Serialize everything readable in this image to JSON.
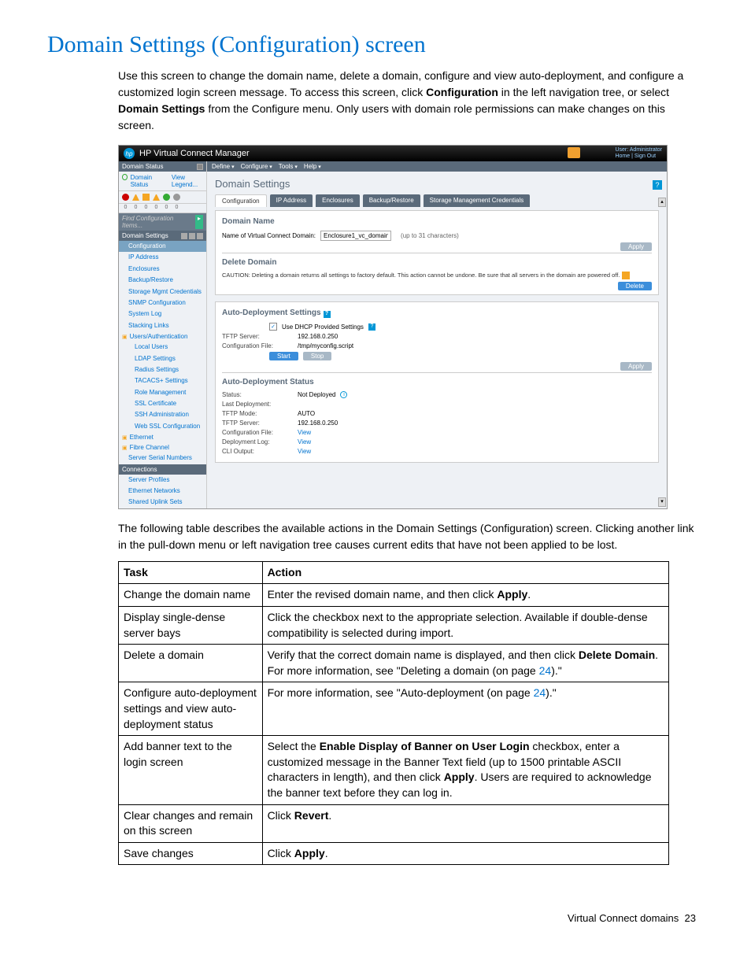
{
  "page": {
    "title": "Domain Settings (Configuration) screen",
    "intro_1a": "Use this screen to change the domain name, delete a domain, configure and view auto-deployment, and configure a customized login screen message. To access this screen, click ",
    "intro_1b": "Configuration",
    "intro_1c": " in the left navigation tree, or select ",
    "intro_1d": "Domain Settings",
    "intro_1e": " from the Configure menu. Only users with domain role permissions can make changes on this screen.",
    "post_text": "The following table describes the available actions in the Domain Settings (Configuration) screen. Clicking another link in the pull-down menu or left navigation tree causes current edits that have not been applied to be lost.",
    "footer_text": "Virtual Connect domains",
    "footer_page": "23"
  },
  "app": {
    "brand": "hp",
    "title": "HP Virtual Connect Manager",
    "user_label": "User: Administrator",
    "links": "Home | Sign Out",
    "menu": [
      "Define",
      "Configure",
      "Tools",
      "Help"
    ],
    "sidebar": {
      "status_header": "Domain Status",
      "status_link": "Domain Status",
      "view_legend": "View Legend...",
      "nums": [
        "0",
        "0",
        "0",
        "0",
        "0",
        "0"
      ],
      "find_placeholder": "Find Configuration Items...",
      "settings_header": "Domain Settings",
      "items1": [
        {
          "label": "Configuration",
          "active": true
        },
        {
          "label": "IP Address"
        },
        {
          "label": "Enclosures"
        },
        {
          "label": "Backup/Restore"
        },
        {
          "label": "Storage Mgmt Credentials"
        },
        {
          "label": "SNMP Configuration"
        },
        {
          "label": "System Log"
        },
        {
          "label": "Stacking Links"
        }
      ],
      "users_header": "Users/Authentication",
      "items2": [
        {
          "label": "Local Users"
        },
        {
          "label": "LDAP Settings"
        },
        {
          "label": "Radius Settings"
        },
        {
          "label": "TACACS+ Settings"
        },
        {
          "label": "Role Management"
        },
        {
          "label": "SSL Certificate"
        },
        {
          "label": "SSH Administration"
        },
        {
          "label": "Web SSL Configuration"
        }
      ],
      "cats": [
        "Ethernet",
        "Fibre Channel"
      ],
      "serial": "Server Serial Numbers",
      "connections": "Connections",
      "items3": [
        "Server Profiles",
        "Ethernet Networks",
        "Shared Uplink Sets"
      ]
    },
    "main": {
      "title": "Domain Settings",
      "tabs": [
        "Configuration",
        "IP Address",
        "Enclosures",
        "Backup/Restore",
        "Storage Management Credentials"
      ],
      "domain_name": {
        "heading": "Domain Name",
        "label": "Name of Virtual Connect Domain:",
        "value": "Enclosure1_vc_domain",
        "hint": "(up to 31 characters)",
        "apply": "Apply"
      },
      "delete": {
        "heading": "Delete Domain",
        "caution": "CAUTION: Deleting a domain returns all settings to factory default. This action cannot be undone. Be sure that all servers in the domain are powered off.",
        "btn": "Delete"
      },
      "autodeploy": {
        "heading": "Auto-Deployment Settings",
        "chk_label": "Use DHCP Provided Settings",
        "tftp_label": "TFTP Server:",
        "tftp_val": "192.168.0.250",
        "cfg_label": "Configuration File:",
        "cfg_val": "/tmp/myconfig.script",
        "start": "Start",
        "stop": "Stop",
        "apply": "Apply"
      },
      "status": {
        "heading": "Auto-Deployment Status",
        "rows": [
          {
            "k": "Status:",
            "v": "Not Deployed",
            "info": true
          },
          {
            "k": "Last Deployment:",
            "v": ""
          },
          {
            "k": "TFTP Mode:",
            "v": "AUTO"
          },
          {
            "k": "TFTP Server:",
            "v": "192.168.0.250"
          },
          {
            "k": "Configuration File:",
            "v": "View",
            "link": true
          },
          {
            "k": "Deployment Log:",
            "v": "View",
            "link": true
          },
          {
            "k": "CLI Output:",
            "v": "View",
            "link": true
          }
        ]
      }
    }
  },
  "table": {
    "headers": [
      "Task",
      "Action"
    ],
    "rows": [
      {
        "task": "Change the domain name",
        "action": "Enter the revised domain name, and then click <b>Apply</b>."
      },
      {
        "task": "Display single-dense server bays",
        "action": "Click the checkbox next to the appropriate selection. Available if double-dense compatibility is selected during import."
      },
      {
        "task": "Delete a domain",
        "action": "Verify that the correct domain name is displayed, and then click <b>Delete Domain</b>. For more information, see \"Deleting a domain (on page <span class='pg-link'>24</span>).\""
      },
      {
        "task": "Configure auto-deployment settings and view auto-deployment status",
        "action": "For more information, see \"Auto-deployment (on page <span class='pg-link'>24</span>).\""
      },
      {
        "task": "Add banner text to the login screen",
        "action": "Select the <b>Enable Display of Banner on User Login</b> checkbox, enter a customized message in the Banner Text field (up to 1500 printable ASCII characters in length), and then click <b>Apply</b>. Users are required to acknowledge the banner text before they can log in."
      },
      {
        "task": "Clear changes and remain on this screen",
        "action": "Click <b>Revert</b>."
      },
      {
        "task": "Save changes",
        "action": "Click <b>Apply</b>."
      }
    ]
  }
}
